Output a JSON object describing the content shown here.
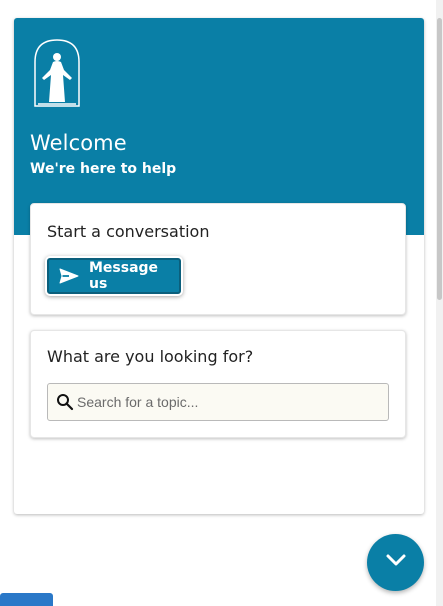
{
  "header": {
    "title": "Welcome",
    "subtitle": "We're here to help",
    "logo_icon": "christus-statue-icon",
    "color": "#0a7fa6"
  },
  "start_card": {
    "title": "Start a conversation",
    "button_label": "Message us",
    "button_icon": "send-icon"
  },
  "search_card": {
    "title": "What are you looking for?",
    "search_placeholder": "Search for a topic...",
    "search_value": ""
  },
  "fab": {
    "icon": "chevron-down-icon"
  },
  "colors": {
    "accent": "#0a7fa6"
  }
}
